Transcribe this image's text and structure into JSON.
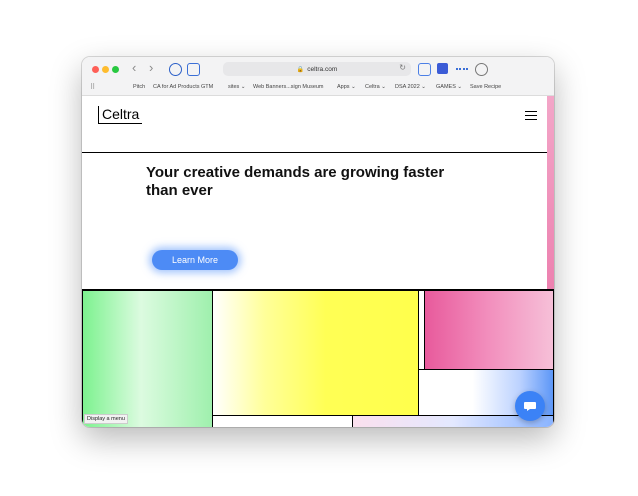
{
  "browser": {
    "nav_back": "‹",
    "nav_forward": "›",
    "address": "celtra.com",
    "lock_icon": "🔒",
    "reload_icon": "↻",
    "bookmarks": [
      "Pitch",
      "CA for Ad Products GTM",
      "sites ⌄",
      "Web Banners...sign Museum",
      "Apps ⌄",
      "Celtra ⌄",
      "DSA 2022 ⌄",
      "GAMES ⌄",
      "Save Recipe"
    ]
  },
  "site": {
    "logo": "Celtra",
    "headline": "Your creative demands are growing faster than ever",
    "cta_label": "Learn More",
    "tooltip": "Display a menu"
  },
  "colors": {
    "accent_blue": "#4d8bf5",
    "tile_green": "#a6f5b3",
    "tile_yellow": "#ffff55",
    "tile_pink": "#ee7fb3"
  }
}
